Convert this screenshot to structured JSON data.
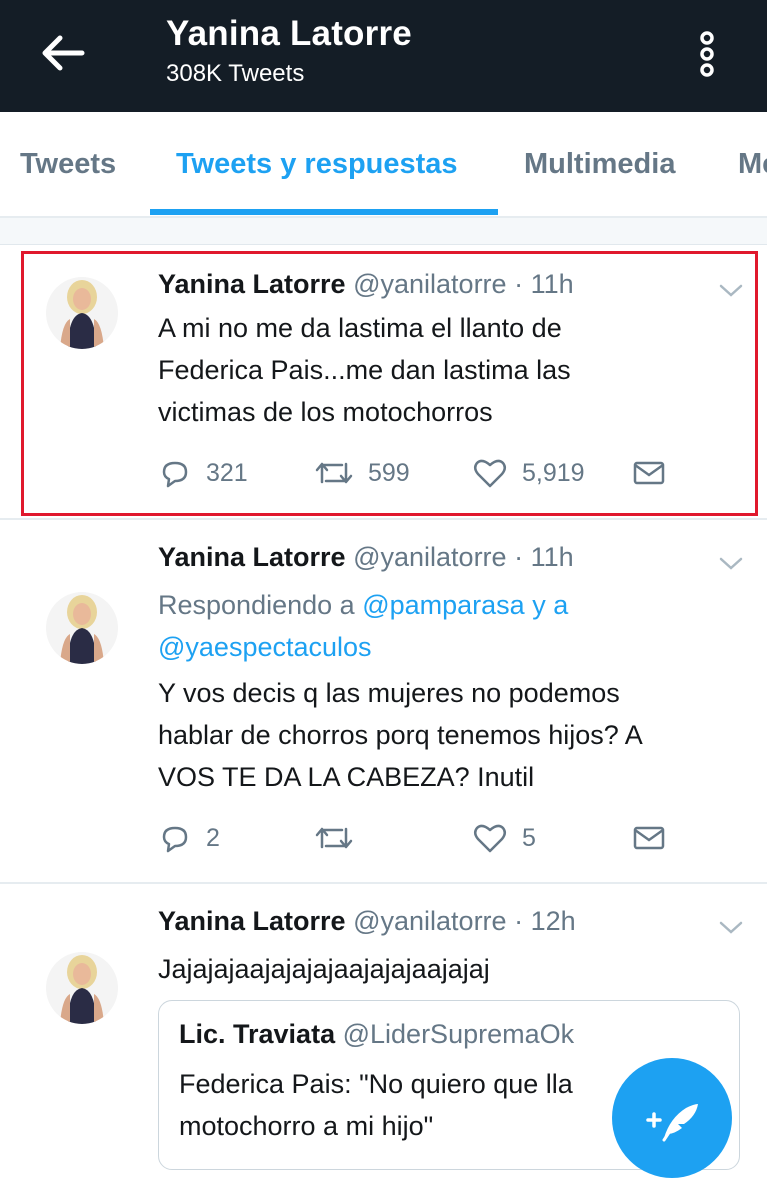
{
  "header": {
    "title": "Yanina Latorre",
    "subtitle": "308K Tweets",
    "back_icon": "arrow-left-icon",
    "menu_icon": "kebab-menu-icon"
  },
  "tabs": [
    {
      "label": "Tweets",
      "active": false
    },
    {
      "label": "Tweets y respuestas",
      "active": true
    },
    {
      "label": "Multimedia",
      "active": false
    },
    {
      "label": "Me",
      "active": false
    }
  ],
  "colors": {
    "accent": "#1da1f2",
    "topbar": "#141d26",
    "highlight": "#e0182d",
    "muted": "#657786"
  },
  "tweets": [
    {
      "name": "Yanina Latorre",
      "handle": "@yanilatorre",
      "time": "· 11h",
      "lines": [
        "A mi no me da lastima el llanto de",
        "Federica Pais...me dan lastima las",
        "victimas de los motochorros"
      ],
      "replies": "321",
      "retweets": "599",
      "likes": "5,919"
    },
    {
      "name": "Yanina Latorre",
      "handle": "@yanilatorre",
      "time": "· 11h",
      "reply_prefix": "Respondiendo a",
      "reply_user1": "@pamparasa",
      "reply_and": "y a",
      "reply_user2": "@yaespectaculos",
      "lines": [
        "Y vos decis q las mujeres no podemos",
        "hablar de chorros porq tenemos hijos? A",
        "VOS TE DA LA CABEZA? Inutil"
      ],
      "replies": "2",
      "likes": "5"
    },
    {
      "name": "Yanina Latorre",
      "handle": "@yanilatorre",
      "time": "· 12h",
      "lines": [
        "Jajajajaajajajajaajajajaajajaj"
      ],
      "quote": {
        "name": "Lic. Traviata",
        "handle": "@LiderSupremaOk",
        "lines": [
          "Federica Pais: \"No quiero que lla",
          "motochorro a mi hijo\""
        ]
      }
    }
  ],
  "fab": {
    "icon": "compose-feather-icon"
  }
}
